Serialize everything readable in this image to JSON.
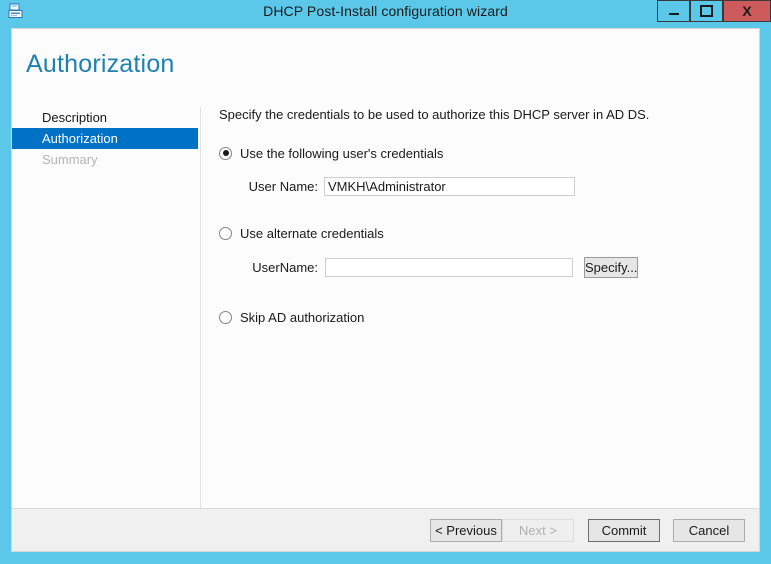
{
  "window": {
    "title": "DHCP Post-Install configuration wizard",
    "icon": "dhcp-server-icon",
    "controls": {
      "minimize": "minimize-icon",
      "maximize": "maximize-icon",
      "close": "X"
    }
  },
  "page": {
    "heading": "Authorization"
  },
  "sidebar": {
    "items": [
      {
        "label": "Description",
        "state": "normal"
      },
      {
        "label": "Authorization",
        "state": "selected"
      },
      {
        "label": "Summary",
        "state": "disabled"
      }
    ]
  },
  "main": {
    "instruction": "Specify the credentials to be used to authorize this DHCP server in AD DS.",
    "options": [
      {
        "label": "Use the following user's credentials",
        "checked": true,
        "field_label": "User Name:",
        "field_value": "VMKH\\Administrator"
      },
      {
        "label": "Use alternate credentials",
        "checked": false,
        "field_label": "UserName:",
        "field_value": "",
        "button_label": "Specify..."
      },
      {
        "label": "Skip AD authorization",
        "checked": false
      }
    ]
  },
  "footer": {
    "previous": "< Previous",
    "next": "Next >",
    "commit": "Commit",
    "cancel": "Cancel"
  },
  "colors": {
    "titlebar": "#5BC8EA",
    "close_button": "#CD5B5B",
    "accent_selected": "#0072C6",
    "heading": "#1E81B0",
    "footer_bg": "#F0F0F0"
  }
}
